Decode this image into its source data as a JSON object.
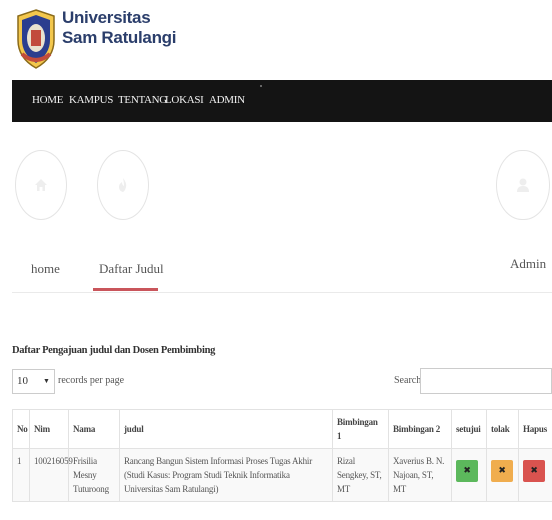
{
  "header": {
    "title_line1": "Universitas",
    "title_line2": "Sam Ratulangi"
  },
  "navbar": {
    "items": [
      "HOME",
      "KAMPUS",
      "TENTANG",
      "LOKASI",
      "ADMIN"
    ]
  },
  "menu": {
    "home_label": "home",
    "daftar_label": "Daftar Judul",
    "admin_label": "Admin"
  },
  "section": {
    "title": "Daftar Pengajuan judul dan Dosen Pembimbing",
    "records_value": "10",
    "records_label": "records per page",
    "search_label": "Search:",
    "search_value": ""
  },
  "table": {
    "headers": [
      "No",
      "Nim",
      "Nama",
      "judul",
      "Bimbingan 1",
      "Bimbingan 2",
      "setujui",
      "tolak",
      "Hapus"
    ],
    "rows": [
      {
        "no": "1",
        "nim": "100216059",
        "nama": "Frisilia Mesny Tuturoong",
        "judul": "Rancang Bangun Sistem Informasi Proses Tugas Akhir (Studi Kasus: Program Studi Teknik Informatika Universitas Sam Ratulangi)",
        "bimbingan1": "Rizal Sengkey, ST, MT",
        "bimbingan2": "Xaverius B. N. Najoan, ST, MT",
        "setujui": "✖",
        "tolak": "✖",
        "hapus": "✖"
      }
    ]
  },
  "colors": {
    "navbar": "#141414",
    "accent": "#c9555b",
    "approve": "#5cb85c",
    "reject": "#f0ad4e",
    "delete": "#d9534f"
  }
}
